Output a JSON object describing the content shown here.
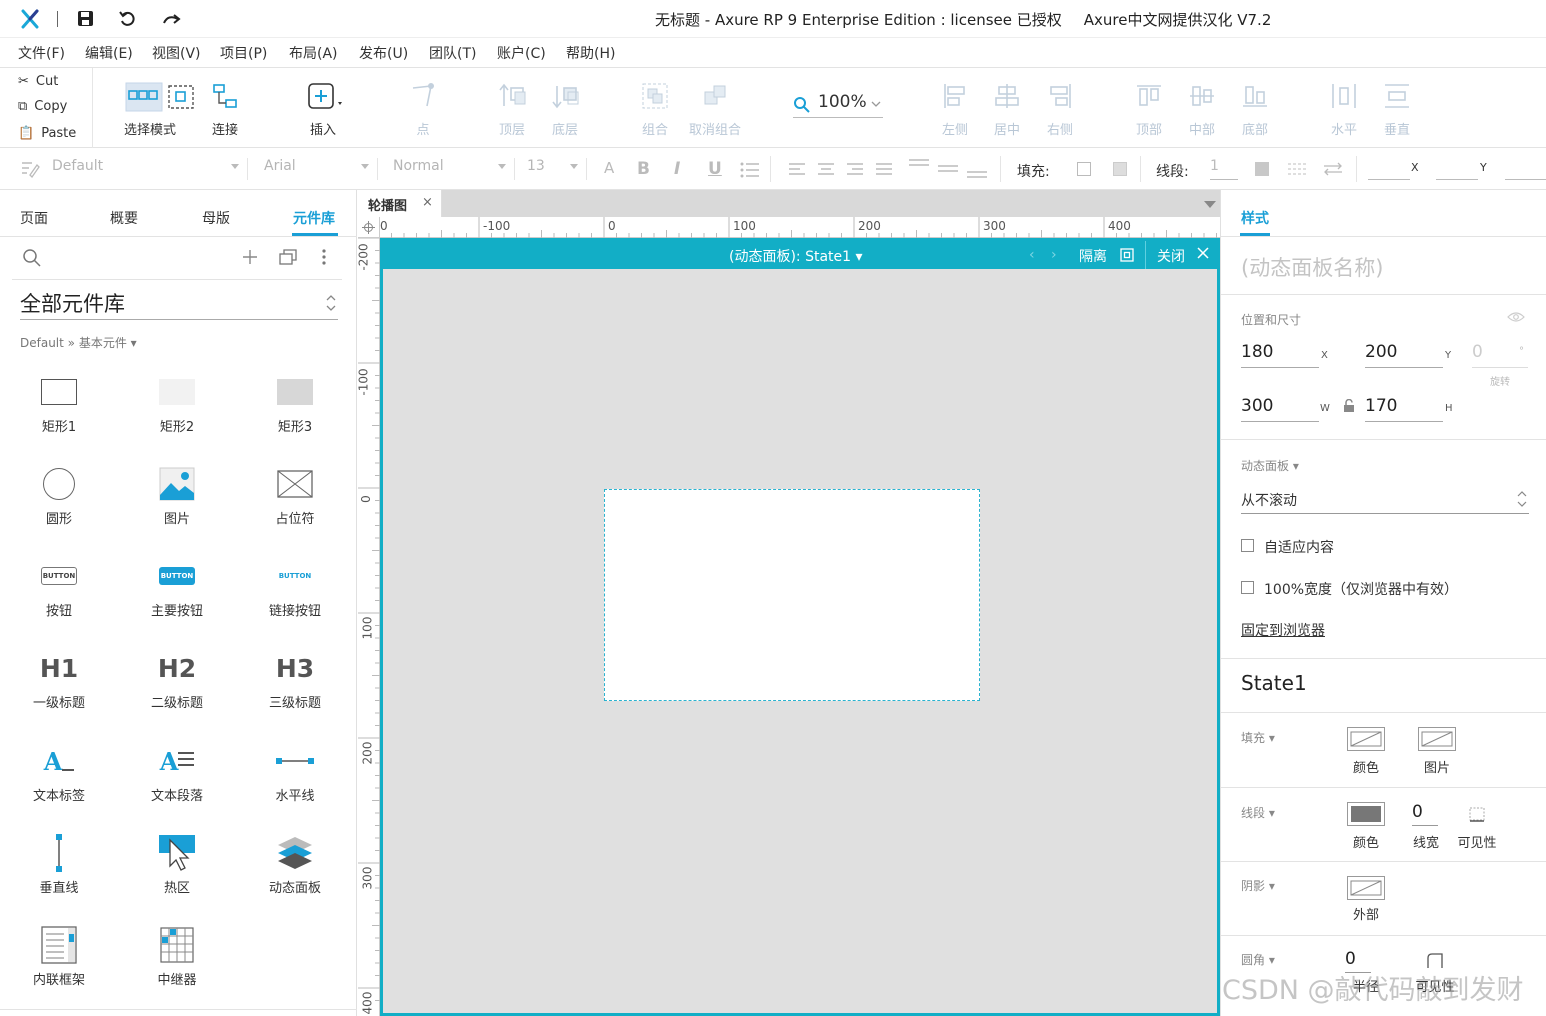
{
  "titlebar": {
    "title": "无标题 - Axure RP 9 Enterprise Edition : licensee 已授权",
    "subtitle": "Axure中文网提供汉化 V7.2"
  },
  "menu": [
    "文件(F)",
    "编辑(E)",
    "视图(V)",
    "项目(P)",
    "布局(A)",
    "发布(U)",
    "团队(T)",
    "账户(C)",
    "帮助(H)"
  ],
  "clipboard": {
    "cut": "Cut",
    "copy": "Copy",
    "paste": "Paste"
  },
  "toolbar": {
    "select_mode": "选择模式",
    "connect": "连接",
    "insert": "插入",
    "point": "点",
    "top_layer": "顶层",
    "bottom_layer": "底层",
    "group": "组合",
    "ungroup": "取消组合",
    "zoom": "100%",
    "align_left": "左侧",
    "align_center": "居中",
    "align_right": "右侧",
    "align_top": "顶部",
    "align_middle": "中部",
    "align_bottom": "底部",
    "distribute_h": "水平",
    "distribute_v": "垂直"
  },
  "formatbar": {
    "style": "Default",
    "font": "Arial",
    "weight": "Normal",
    "size": "13",
    "fill_label": "填充:",
    "stroke_label": "线段:",
    "stroke_value": "1",
    "x_label": "X",
    "y_label": "Y"
  },
  "leftpanel": {
    "tabs": [
      "页面",
      "概要",
      "母版",
      "元件库"
    ],
    "library": "全部元件库",
    "breadcrumb": "Default » 基本元件 ▾",
    "widgets": [
      "矩形1",
      "矩形2",
      "矩形3",
      "圆形",
      "图片",
      "占位符",
      "按钮",
      "主要按钮",
      "链接按钮",
      "一级标题",
      "二级标题",
      "三级标题",
      "文本标签",
      "文本段落",
      "水平线",
      "垂直线",
      "热区",
      "动态面板",
      "内联框架",
      "中继器"
    ],
    "icon_text": {
      "button": "BUTTON",
      "h1": "H1",
      "h2": "H2",
      "h3": "H3",
      "label_a": "A",
      "para_a": "A"
    }
  },
  "canvas": {
    "tab": "轮播图",
    "tab_close": "×",
    "ruler_h": [
      "-100",
      "0",
      "100",
      "200",
      "300",
      "400"
    ],
    "ruler_h_origin": "0",
    "ruler_v": [
      "-200",
      "-100",
      "0",
      "100",
      "200",
      "300",
      "400"
    ],
    "panel_state": "(动态面板): State1 ▾",
    "isolate": "隔离",
    "close": "关闭"
  },
  "rightpanel": {
    "tab": "样式",
    "name_placeholder": "(动态面板名称)",
    "pos_size_label": "位置和尺寸",
    "x": "180",
    "x_unit": "X",
    "y": "200",
    "y_unit": "Y",
    "rotation": "0",
    "rotation_unit": "°",
    "rotation_label": "旋转",
    "w": "300",
    "w_unit": "W",
    "h": "170",
    "h_unit": "H",
    "dp_label": "动态面板 ▾",
    "scroll": "从不滚动",
    "fit_content": "自适应内容",
    "full_width": "100%宽度（仅浏览器中有效）",
    "pin": "固定到浏览器",
    "state": "State1",
    "fill_label": "填充 ▾",
    "fill_color": "颜色",
    "fill_image": "图片",
    "stroke_label": "线段 ▾",
    "stroke_color": "颜色",
    "stroke_width_value": "0",
    "stroke_width": "线宽",
    "stroke_visibility": "可见性",
    "shadow_label": "阴影 ▾",
    "shadow_outer": "外部",
    "corner_label": "圆角 ▾",
    "corner_value": "0",
    "corner_radius": "半径",
    "corner_visibility": "可见性"
  },
  "watermark": "CSDN @敲代码敲到发财",
  "colors": {
    "accent": "#12aec6",
    "tab_active": "#1a9fd6",
    "disabled": "#b9c7d6"
  }
}
